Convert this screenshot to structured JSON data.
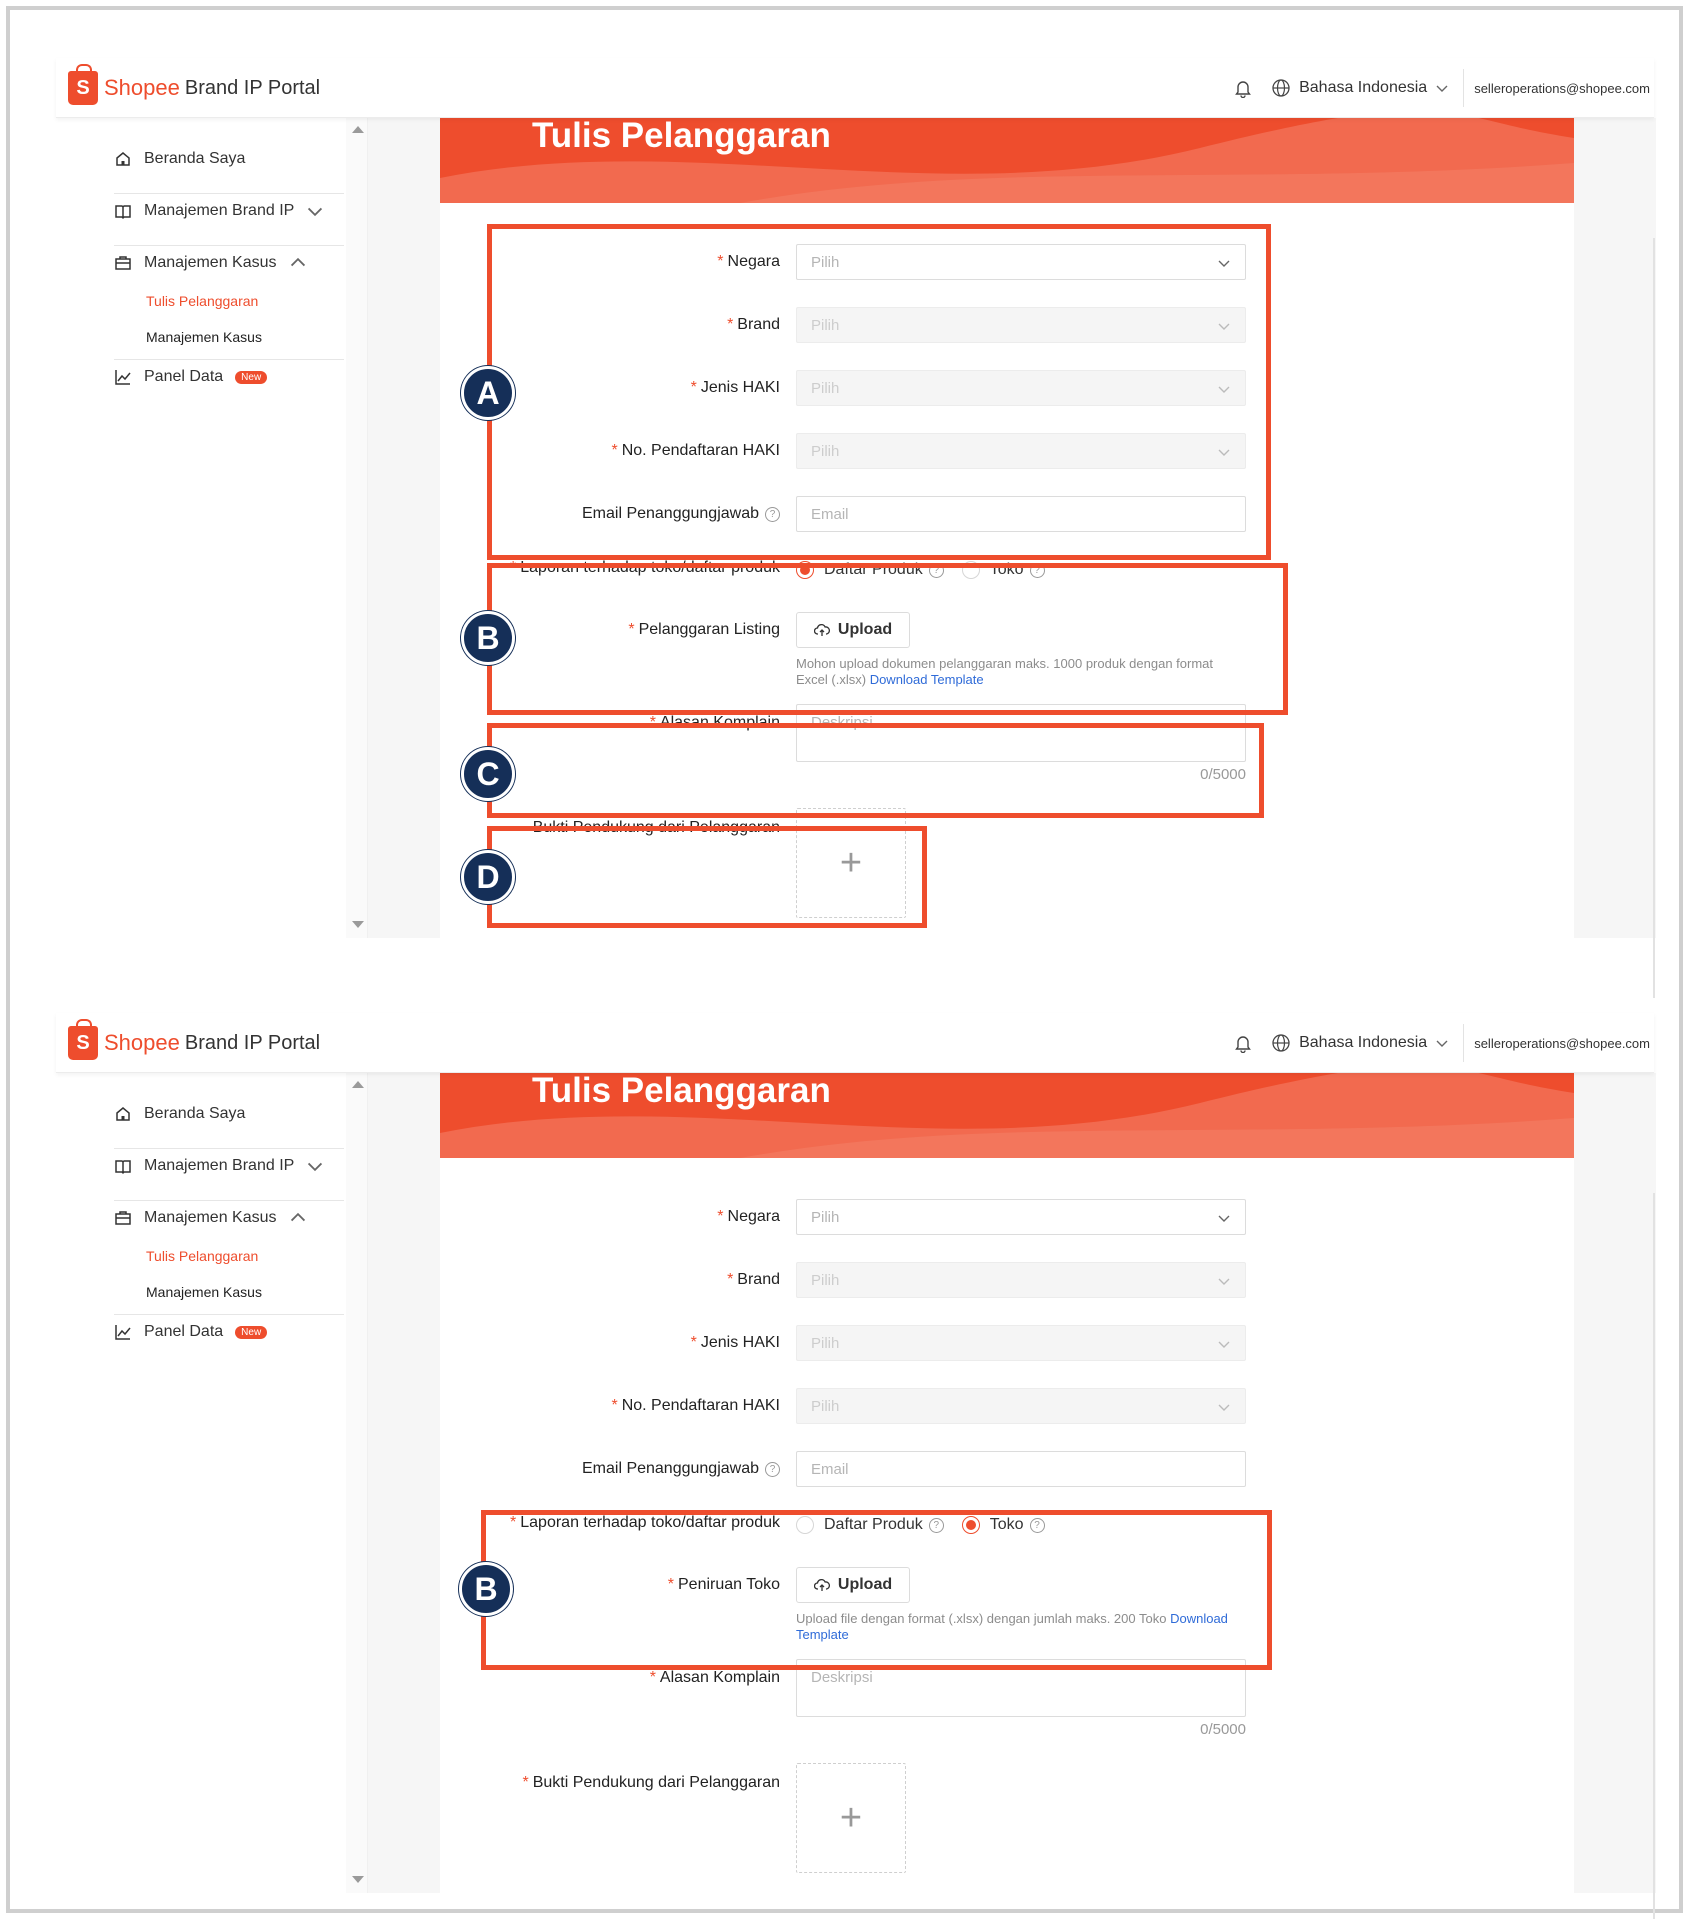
{
  "header": {
    "logo_s": "S",
    "logo_brand": "Shopee",
    "logo_rest": "Brand IP Portal",
    "language": "Bahasa Indonesia",
    "account_email": "selleroperations@shopee.com"
  },
  "sidebar": {
    "home": "Beranda Saya",
    "brand_management": "Manajemen Brand IP",
    "case_management": "Manajemen Kasus",
    "sub_write": "Tulis Pelanggaran",
    "sub_cases": "Manajemen Kasus",
    "panel_data": "Panel Data",
    "new_badge": "New"
  },
  "page": {
    "title": "Tulis Pelanggaran"
  },
  "form": {
    "country_label": "Negara",
    "brand_label": "Brand",
    "ip_type_label": "Jenis HAKI",
    "ip_reg_label": "No. Pendaftaran HAKI",
    "email_label": "Email Penanggungjawab",
    "select_placeholder": "Pilih",
    "email_placeholder": "Email",
    "report_label": "Laporan terhadap toko/daftar produk",
    "option_product": "Daftar Produk",
    "option_shop": "Toko",
    "listing_label": "Pelanggaran Listing",
    "shop_label": "Peniruan Toko",
    "upload_label": "Upload",
    "listing_hint": "Mohon upload dokumen pelanggaran maks. 1000 produk dengan format Excel (.xlsx)",
    "shop_hint": "Upload file dengan format (.xlsx) dengan jumlah maks. 200 Toko",
    "download_template": "Download Template",
    "reason_label": "Alasan Komplain",
    "reason_placeholder": "Deskripsi",
    "reason_counter": "0/5000",
    "evidence_label": "Bukti Pendukung dari Pelanggaran",
    "required_mark": "*",
    "help_mark": "?"
  },
  "annotations": {
    "a": "A",
    "b": "B",
    "c": "C",
    "d": "D"
  },
  "selected_report_type": {
    "screenshot_1": "Daftar Produk",
    "screenshot_2": "Toko"
  },
  "colors": {
    "brand": "#ee4d2d",
    "annotation_circle": "#152f58",
    "link": "#2f6bd8"
  }
}
